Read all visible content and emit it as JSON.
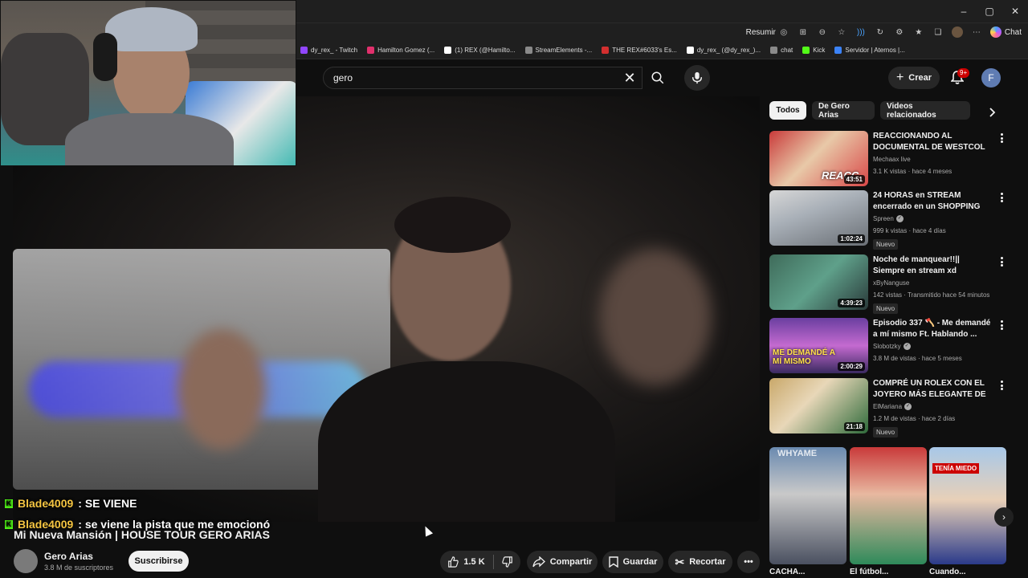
{
  "browser": {
    "toolbar": {
      "summarize": "Resumir",
      "copilot": "Chat"
    },
    "window_controls": [
      "–",
      "▢",
      "✕"
    ],
    "bookmarks": [
      {
        "label": "dy_rex_ - Twitch",
        "color": "#9146ff"
      },
      {
        "label": "Hamilton Gomez (...",
        "color": "#e1306c"
      },
      {
        "label": "(1) REX (@Hamilto...",
        "color": "#ffffff"
      },
      {
        "label": "StreamElements -...",
        "color": "#8a8a8a"
      },
      {
        "label": "THE REX#6033's Es...",
        "color": "#d32f2f"
      },
      {
        "label": "dy_rex_ (@dy_rex_)...",
        "color": "#ffffff"
      },
      {
        "label": "chat",
        "color": "#8a8a8a"
      },
      {
        "label": "Kick",
        "color": "#53fc18"
      },
      {
        "label": "Servidor | Aternos |...",
        "color": "#3b82f6"
      }
    ]
  },
  "header": {
    "search_value": "gero",
    "create_label": "Crear",
    "notifications_badge": "9+",
    "avatar_letter": "F"
  },
  "chat": [
    {
      "user": "Blade4009",
      "message": ": SE VIENE"
    },
    {
      "user": "Blade4009",
      "message": ": se viene la pista que me emocionó"
    }
  ],
  "video": {
    "title": "Mi Nueva Mansión | HOUSE TOUR GERO ARIAS",
    "channel": "Gero Arias",
    "subscribers": "3.8 M de suscriptores",
    "subscribe_label": "Suscribirse",
    "likes": "1.5 K",
    "share_label": "Compartir",
    "save_label": "Guardar",
    "clip_label": "Recortar"
  },
  "sidebar": {
    "chips": [
      "Todos",
      "De Gero Arias",
      "Videos relacionados"
    ],
    "recommendations": [
      {
        "title": "REACCIONANDO AL DOCUMENTAL DE WESTCOL ...",
        "channel": "Mechaax live",
        "verified": false,
        "meta": "3.1 K vistas · hace 4 meses",
        "duration": "43:51",
        "badge": "",
        "overlay": "REACC"
      },
      {
        "title": "24 HORAS en STREAM encerrado en un SHOPPING",
        "channel": "Spreen",
        "verified": true,
        "meta": "999 k vistas · hace 4 días",
        "duration": "1:02:24",
        "badge": "Nuevo",
        "overlay": ""
      },
      {
        "title": "Noche de manquear!!|| Siempre en stream xd",
        "channel": "xByNanguse",
        "verified": false,
        "meta": "142 vistas · Transmitido hace 54 minutos",
        "duration": "4:39:23",
        "badge": "Nuevo",
        "overlay": ""
      },
      {
        "title": "Episodio 337 🪓 - Me demandé a mí mismo Ft. Hablando ...",
        "channel": "Slobotzky",
        "verified": true,
        "meta": "3.8 M de vistas · hace 5 meses",
        "duration": "2:00:29",
        "badge": "",
        "overlay": "ME DEMANDÉ A MÍ MISMO"
      },
      {
        "title": "COMPRÉ UN ROLEX CON EL JOYERO MÁS ELEGANTE DE ...",
        "channel": "ElMariana",
        "verified": true,
        "meta": "1.2 M de vistas · hace 2 días",
        "duration": "21:18",
        "badge": "Nuevo",
        "overlay": ""
      }
    ],
    "shorts": [
      {
        "title": "CACHA...",
        "overlay": "WHYAME"
      },
      {
        "title": "El fútbol...",
        "overlay": ""
      },
      {
        "title": "Cuando...",
        "overlay": "TENÍA MIEDO"
      }
    ]
  }
}
